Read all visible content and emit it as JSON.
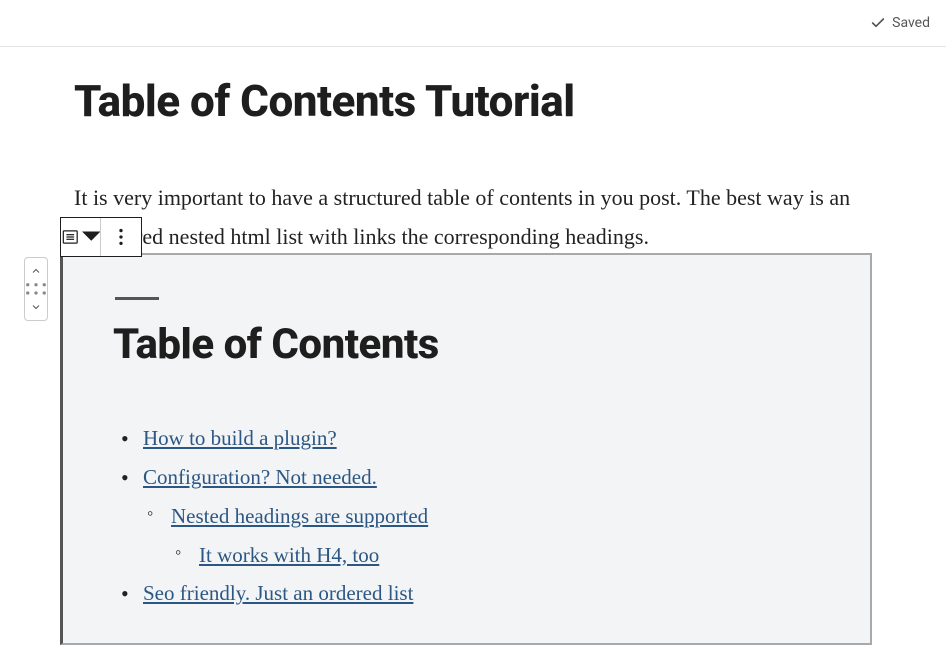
{
  "topbar": {
    "saved_label": "Saved"
  },
  "editor": {
    "title": "Table of Contents Tutorial",
    "intro": "It is very important to have a structured table of contents in you post. The best way is an unordered nested html list with links the corresponding headings."
  },
  "toc": {
    "heading": "Table of Contents",
    "items": [
      {
        "label": "How to build a plugin?",
        "children": []
      },
      {
        "label": "Configuration? Not needed.",
        "children": [
          {
            "label": "Nested headings are supported",
            "children": [
              {
                "label": "It works with H4, too"
              }
            ]
          }
        ]
      },
      {
        "label": "Seo friendly. Just an ordered list",
        "children": []
      }
    ]
  }
}
